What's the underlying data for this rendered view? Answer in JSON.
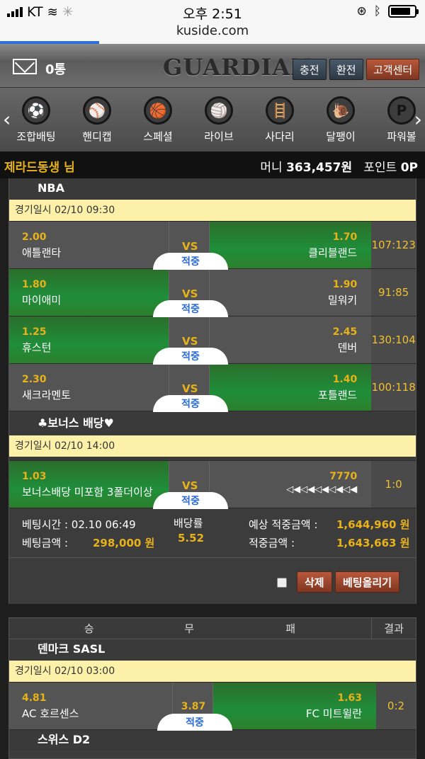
{
  "status": {
    "carrier": "KT",
    "time": "오후 2:51",
    "url": "kuside.com"
  },
  "header": {
    "mail_count": "0통",
    "logo": "GUARDIAN",
    "btn_charge": "충전",
    "btn_exchange": "환전",
    "btn_support": "고객센터"
  },
  "nav": {
    "prev": "‹",
    "next": "›",
    "items": [
      {
        "label": "조합배팅",
        "icon": "soccer-ball-icon",
        "glyph": "⚽"
      },
      {
        "label": "핸디캡",
        "icon": "baseball-icon",
        "glyph": "⚾"
      },
      {
        "label": "스페셜",
        "icon": "basketball-icon",
        "glyph": "🏀"
      },
      {
        "label": "라이브",
        "icon": "volleyball-icon",
        "glyph": "🏐"
      },
      {
        "label": "사다리",
        "icon": "ladder-icon",
        "glyph": "🪜"
      },
      {
        "label": "달팽이",
        "icon": "snail-icon",
        "glyph": "🐌"
      },
      {
        "label": "파워볼",
        "icon": "powerball-icon",
        "glyph": "P"
      }
    ]
  },
  "user": {
    "name": "제라드동생 님",
    "money_label": "머니",
    "money": "363,457원",
    "point_label": "포인트",
    "point": "0P"
  },
  "slip1": {
    "league": "NBA",
    "date1": "경기일시 02/10  09:30",
    "matches": [
      {
        "home_odd": "2.00",
        "home": "애틀랜타",
        "vs": "VS",
        "pick": "적중",
        "away_odd": "1.70",
        "away": "클리블랜드",
        "result": "107:123",
        "sel": "away"
      },
      {
        "home_odd": "1.80",
        "home": "마이애미",
        "vs": "VS",
        "pick": "적중",
        "away_odd": "1.90",
        "away": "밀워키",
        "result": "91:85",
        "sel": "home"
      },
      {
        "home_odd": "1.25",
        "home": "휴스턴",
        "vs": "VS",
        "pick": "적중",
        "away_odd": "2.45",
        "away": "덴버",
        "result": "130:104",
        "sel": "home"
      },
      {
        "home_odd": "2.30",
        "home": "새크라멘토",
        "vs": "VS",
        "pick": "적중",
        "away_odd": "1.40",
        "away": "포틀랜드",
        "result": "100:118",
        "sel": "away"
      }
    ],
    "bonus_title": "♣보너스 배당♥",
    "date2": "경기일시 02/10  14:00",
    "bonus": {
      "home_odd": "1.03",
      "home": "보너스배당 미포함 3폴더이상",
      "vs": "VS",
      "pick": "적중",
      "away_odd": "7770",
      "away": "◁◀◁◀◁◀◁◀◁◀",
      "result": "1:0"
    },
    "bet_time_label": "베팅시간 : 02.10 06:49",
    "bet_amount_label": "베팅금액 :",
    "bet_amount": "298,000 원",
    "odds_label": "배당률",
    "odds": "5.52",
    "expected_label": "예상 적중금액 :",
    "expected": "1,644,960 원",
    "won_label": "적중금액 :",
    "won": "1,643,663 원",
    "delete": "삭제",
    "post": "베팅올리기"
  },
  "slip2": {
    "cols": [
      "승",
      "무",
      "패",
      "결과"
    ],
    "league": "덴마크 SASL",
    "date1": "경기일시 02/10  03:00",
    "match": {
      "home_odd": "4.81",
      "home": "AC 호르센스",
      "draw_odd": "3.87",
      "pick": "적중",
      "away_odd": "1.63",
      "away": "FC 미트윌란",
      "result": "0:2",
      "sel": "away"
    },
    "next_league": "스위스 D2"
  },
  "ghost_cols": [
    "승",
    "무",
    "패",
    "결과"
  ]
}
